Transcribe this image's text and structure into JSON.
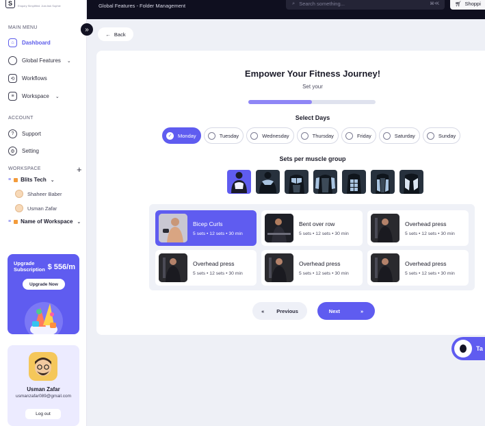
{
  "brand": {
    "tagline": "Enquiry Simplified. Just Ask Sophie"
  },
  "topbar": {
    "breadcrumb": "Global Features - Folder Management",
    "search_placeholder": "Search something...",
    "search_shortcut": "⌘+K",
    "shop_label": "Shoppi"
  },
  "sidebar": {
    "main_menu_title": "MAIN MENU",
    "main_items": [
      {
        "label": "Dashboard",
        "icon": "home-icon"
      },
      {
        "label": "Global Features",
        "icon": "user-icon"
      },
      {
        "label": "Workflows",
        "icon": "workflow-icon"
      },
      {
        "label": "Workspace",
        "icon": "workspace-icon"
      }
    ],
    "account_title": "ACCOUNT",
    "account_items": [
      {
        "label": "Support",
        "icon": "help-icon"
      },
      {
        "label": "Setting",
        "icon": "settings-icon"
      }
    ],
    "workspace_title": "WORKSPACE",
    "workspaces": [
      {
        "name": "Blits Tech",
        "members": [
          "Shaheer Baber",
          "Usman Zafar"
        ]
      },
      {
        "name": "Name of Workspace"
      }
    ],
    "upgrade": {
      "title": "Upgrade Subscription",
      "price": "$ 556/m",
      "button": "Upgrade Now"
    },
    "profile": {
      "name": "Usman Zafar",
      "email": "usmanzafar089@gmail.com",
      "logout": "Log out"
    }
  },
  "main": {
    "back_label": "Back",
    "title": "Empower Your Fitness Journey!",
    "subtitle": "Set your",
    "progress": 0.5,
    "days_title": "Select Days",
    "days": [
      "Monday",
      "Tuesday",
      "Wednesday",
      "Thursday",
      "Friday",
      "Saturday",
      "Sunday"
    ],
    "selected_day": "Monday",
    "muscle_title": "Sets per muscle group",
    "exercises": [
      {
        "name": "Bicep Curls",
        "meta": "5 sets • 12 sets • 30 min"
      },
      {
        "name": "Bent over row",
        "meta": "5 sets • 12 sets • 30 min"
      },
      {
        "name": "Overhead press",
        "meta": "5 sets • 12 sets • 30 min"
      },
      {
        "name": "Overhead press",
        "meta": "5 sets • 12 sets • 30 min"
      },
      {
        "name": "Overhead press",
        "meta": "5 sets • 12 sets • 30 min"
      },
      {
        "name": "Overhead press",
        "meta": "5 sets • 12 sets • 30 min"
      }
    ],
    "previous_label": "Previous",
    "next_label": "Next"
  },
  "chat": {
    "label": "Ta"
  },
  "colors": {
    "accent": "#5f5cf0",
    "topbar": "#0f0f1f",
    "muscle_tile": "#27313d"
  }
}
